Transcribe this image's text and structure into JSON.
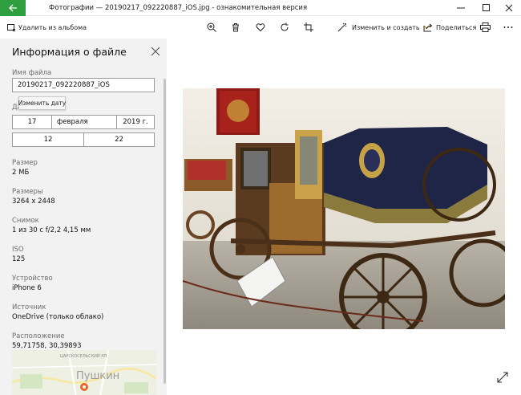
{
  "titlebar": {
    "title": "Фотографии — 20190217_092220887_iOS.jpg - ознакомительная версия"
  },
  "cmdbar": {
    "remove_label": "Удалить из альбома",
    "edit_create_label": "Изменить и создать",
    "share_label": "Поделиться"
  },
  "panel": {
    "title": "Информация о файле",
    "file_name_label": "Имя файла",
    "file_name_value": "20190217_092220887_iOS",
    "date_label_partial": "Да",
    "tooltip": "Изменить дату",
    "date_day": "17",
    "date_month": "февраля",
    "date_year": "2019 г.",
    "time_hour": "12",
    "time_minute": "22",
    "size_label": "Размер",
    "size_value": "2 МБ",
    "dims_label": "Размеры",
    "dims_value": "3264 x 2448",
    "shot_label": "Снимок",
    "shot_value": "1 из 30 с f/2,2 4,15 мм",
    "iso_label": "ISO",
    "iso_value": "125",
    "device_label": "Устройство",
    "device_value": "iPhone 6",
    "source_label": "Источник",
    "source_value": "OneDrive (только облако)",
    "location_label": "Расположение",
    "location_value": "59,71758, 30,39893",
    "map_road": "ЦАРСКОСЕЛЬСКИЙ КП",
    "map_city": "Пушкин"
  },
  "colors": {
    "back_button": "#2e9e3e",
    "panel_bg": "#f2f2f2",
    "map_pin": "#e8662c"
  }
}
